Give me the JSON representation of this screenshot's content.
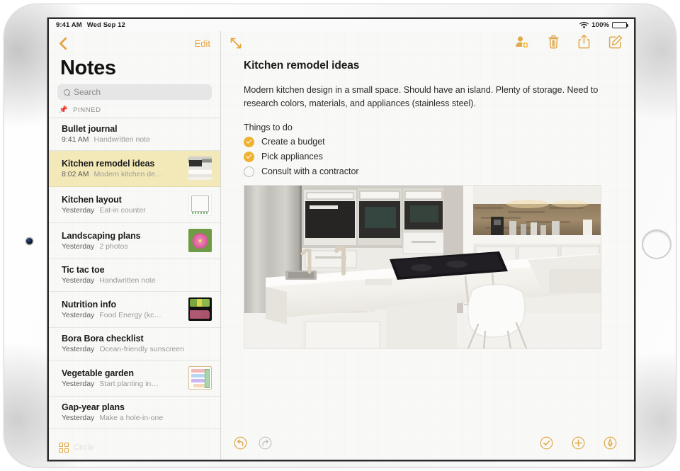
{
  "status_bar": {
    "time": "9:41 AM",
    "date": "Wed Sep 12",
    "battery_percent": "100%",
    "wifi_icon": "wifi-icon",
    "battery_icon": "battery-full-icon"
  },
  "sidebar": {
    "back_icon": "chevron-left-icon",
    "edit_label": "Edit",
    "title": "Notes",
    "search": {
      "placeholder": "Search",
      "value": "",
      "icon": "search-icon"
    },
    "pinned_section": {
      "label": "PINNED",
      "icon": "pin-icon"
    },
    "footer": {
      "icon": "grid-folders-icon",
      "label": "Circle"
    },
    "notes": [
      {
        "title": "Bullet journal",
        "time": "9:41 AM",
        "snippet": "Handwritten note",
        "thumb": "none",
        "selected": false
      },
      {
        "title": "Kitchen remodel ideas",
        "time": "8:02 AM",
        "snippet": "Modern kitchen de…",
        "thumb": "kitchen",
        "selected": true
      },
      {
        "title": "Kitchen layout",
        "time": "Yesterday",
        "snippet": "Eat-in counter",
        "thumb": "plan",
        "selected": false
      },
      {
        "title": "Landscaping plans",
        "time": "Yesterday",
        "snippet": "2 photos",
        "thumb": "flower",
        "selected": false
      },
      {
        "title": "Tic tac toe",
        "time": "Yesterday",
        "snippet": "Handwritten note",
        "thumb": "none",
        "selected": false
      },
      {
        "title": "Nutrition info",
        "time": "Yesterday",
        "snippet": "Food Energy (kc…",
        "thumb": "food",
        "selected": false
      },
      {
        "title": "Bora Bora checklist",
        "time": "Yesterday",
        "snippet": "Ocean-friendly sunscreen",
        "thumb": "none",
        "selected": false
      },
      {
        "title": "Vegetable garden",
        "time": "Yesterday",
        "snippet": "Start planting in…",
        "thumb": "garden",
        "selected": false
      },
      {
        "title": "Gap-year plans",
        "time": "Yesterday",
        "snippet": "Make a hole-in-one",
        "thumb": "none",
        "selected": false
      }
    ]
  },
  "detail": {
    "expand_icon": "expand-collapse-icon",
    "actions": [
      {
        "name": "add-collaborator-icon"
      },
      {
        "name": "trash-icon"
      },
      {
        "name": "share-icon"
      },
      {
        "name": "compose-icon"
      }
    ],
    "note_title": "Kitchen remodel ideas",
    "paragraph_line_1": "Modern kitchen design in a small space. Should have an island. Plenty of storage.",
    "paragraph_line_2": "Need to research colors, materials, and appliances (stainless steel).",
    "todo_heading": "Things to do",
    "todos": [
      {
        "label": "Create a budget",
        "checked": true
      },
      {
        "label": "Pick appliances",
        "checked": true
      },
      {
        "label": "Consult with a contractor",
        "checked": false
      }
    ],
    "photo_alt": "Modern white kitchen with island, cooktop and white chair"
  },
  "bottom_toolbar": {
    "left": [
      {
        "name": "undo-icon",
        "enabled": true
      },
      {
        "name": "redo-icon",
        "enabled": false
      }
    ],
    "right": [
      {
        "name": "checklist-icon"
      },
      {
        "name": "add-attachment-icon"
      },
      {
        "name": "markup-pen-icon"
      }
    ]
  },
  "colors": {
    "accent": "#E8A33D",
    "checkbox_filled": "#EFB230",
    "selected_row": "#F3E9B8",
    "paper": "#FAFAF8",
    "disabled": "#C3C3C1"
  }
}
